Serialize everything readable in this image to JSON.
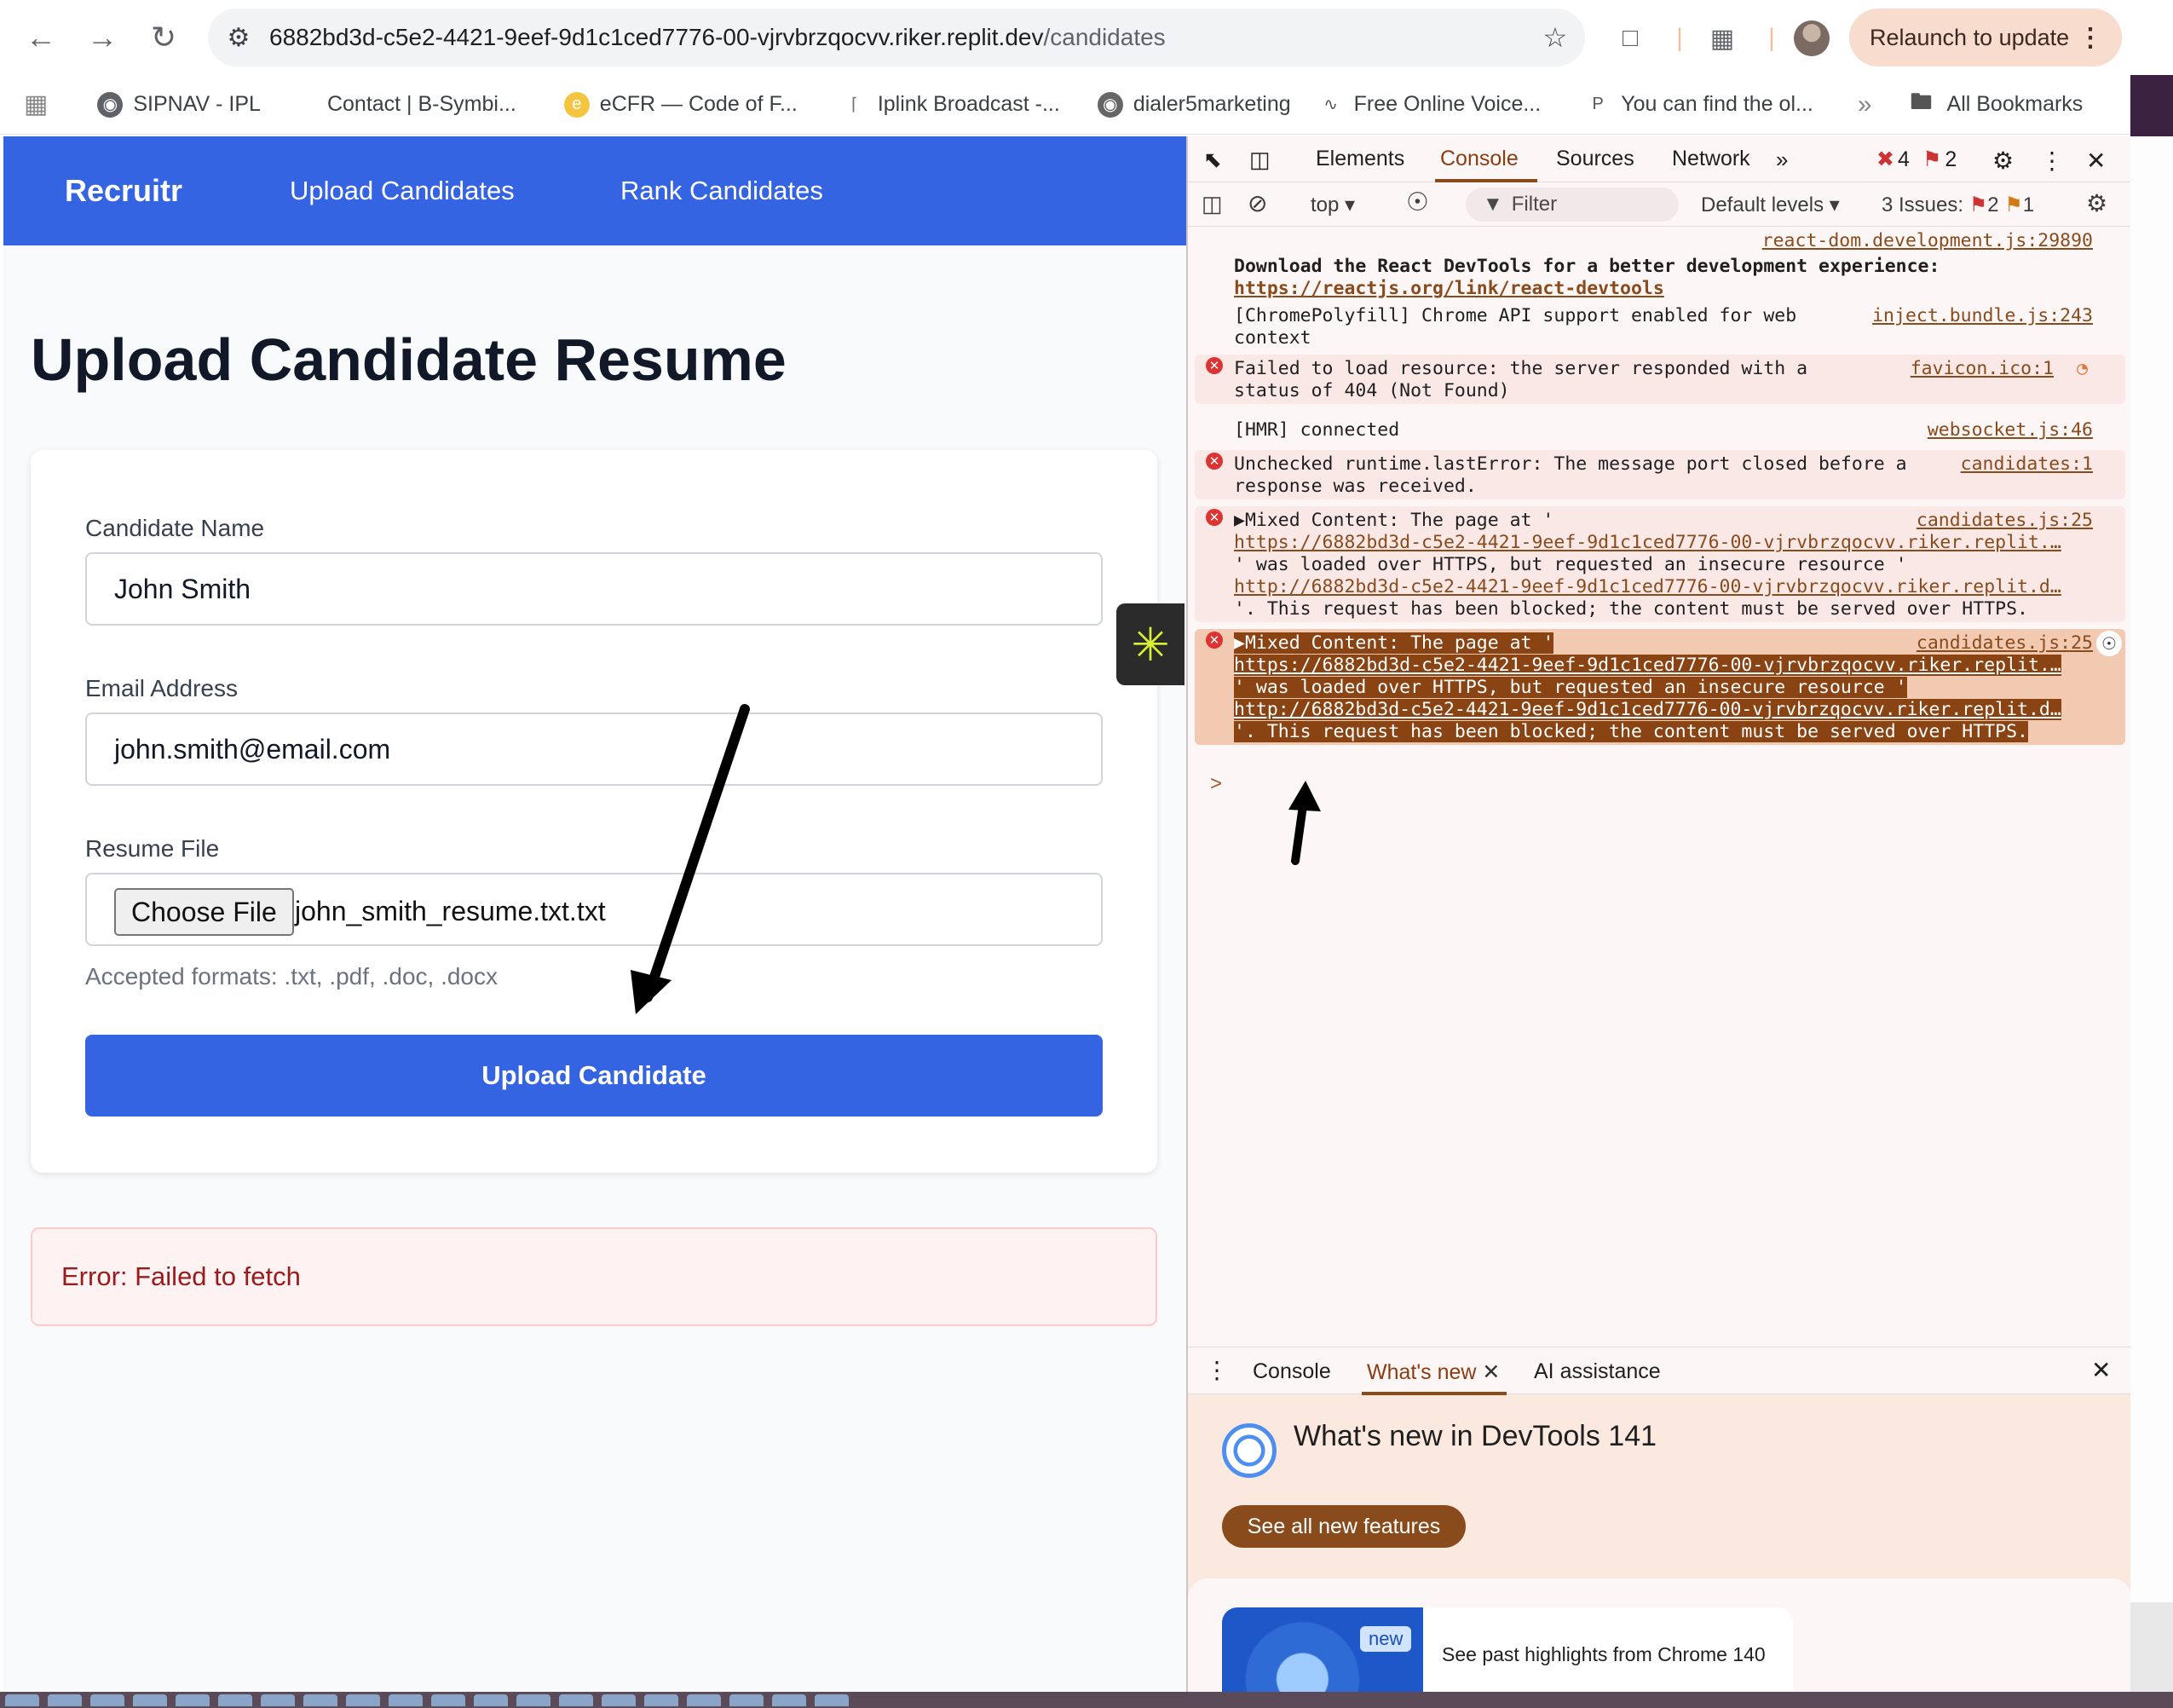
{
  "browser": {
    "url_host": "6882bd3d-c5e2-4421-9eef-9d1c1ced7776-00-vjrvbrzqocvv.riker.replit.dev",
    "url_path": "/candidates",
    "relaunch_label": "Relaunch to update",
    "bookmarks": [
      "SIPNAV - IPL",
      "Contact | B-Symbi...",
      "eCFR — Code of F...",
      "Iplink Broadcast -...",
      "dialer5marketing",
      "Free Online Voice...",
      "You can find the ol..."
    ],
    "bookmarks_more": "»",
    "all_bookmarks": "All Bookmarks"
  },
  "app": {
    "brand": "Recruitr",
    "nav": [
      "Upload Candidates",
      "Rank Candidates"
    ],
    "page_title": "Upload Candidate Resume",
    "form": {
      "name_label": "Candidate Name",
      "name_value": "John Smith",
      "email_label": "Email Address",
      "email_value": "john.smith@email.com",
      "file_label": "Resume File",
      "file_button": "Choose File",
      "file_name": "john_smith_resume.txt.txt",
      "file_hint": "Accepted formats: .txt, .pdf, .doc, .docx",
      "submit_label": "Upload Candidate"
    },
    "error_text": "Error: Failed to fetch"
  },
  "devtools": {
    "tabs": [
      "Elements",
      "Console",
      "Sources",
      "Network"
    ],
    "active_tab": "Console",
    "error_count": "4",
    "issue_count": "2",
    "context": "top",
    "filter_placeholder": "Filter",
    "levels": "Default levels",
    "issues_label": "3 Issues:",
    "issues_errors": "2",
    "issues_warnings": "1",
    "messages": [
      {
        "src": "react-dom.development.js:29890",
        "text": "Download the React DevTools for a better development experience:",
        "link": "https://reactjs.org/link/react-devtools"
      },
      {
        "src": "inject.bundle.js:243",
        "text": "[ChromePolyfill] Chrome API support enabled for web",
        "text2": "context"
      },
      {
        "src": "favicon.ico:1",
        "text": "Failed to load resource: the server responded with a",
        "text2": "status of 404 (Not Found)"
      },
      {
        "src": "websocket.js:46",
        "text": "[HMR] connected"
      },
      {
        "src": "candidates:1",
        "text": "Unchecked runtime.lastError: The message port closed before a",
        "text2": "response was received."
      },
      {
        "src": "candidates.js:25",
        "text": "▶Mixed Content: The page at '",
        "link1": "https://6882bd3d-c5e2-4421-9eef-9d1c1ced7776-00-vjrvbrzqocvv.riker.replit.…",
        "text2": "' was loaded over HTTPS, but requested an insecure resource '",
        "link2": "http://6882bd3d-c5e2-4421-9eef-9d1c1ced7776-00-vjrvbrzqocvv.riker.replit.d…",
        "text3": "'. This request has been blocked; the content must be served over HTTPS."
      },
      {
        "src": "candidates.js:25",
        "text": "▶Mixed Content: The page at '",
        "link1": "https://6882bd3d-c5e2-4421-9eef-9d1c1ced7776-00-vjrvbrzqocvv.riker.replit.…",
        "text2": "' was loaded over HTTPS, but requested an insecure resource '",
        "link2": "http://6882bd3d-c5e2-4421-9eef-9d1c1ced7776-00-vjrvbrzqocvv.riker.replit.d…",
        "text3": "'. This request has been blocked; the content must be served over HTTPS."
      }
    ],
    "prompt": ">",
    "drawer": {
      "tabs": [
        "Console",
        "What's new",
        "AI assistance"
      ],
      "title": "What's new in DevTools 141",
      "see_all": "See all new features",
      "new_badge": "new",
      "highlight_text": "See past highlights from Chrome 140"
    }
  },
  "colors": {
    "accent": "#3564e3",
    "error_text": "#991b1b",
    "devtools_accent": "#8a4b1c"
  }
}
